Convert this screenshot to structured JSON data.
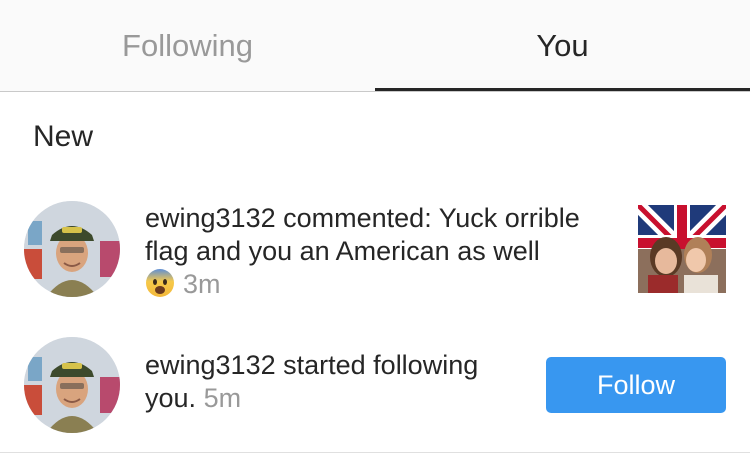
{
  "tabs": {
    "following_label": "Following",
    "you_label": "You",
    "active": "You"
  },
  "section_header": "New",
  "notifications": [
    {
      "username": "ewing3132",
      "action_text": " commented: Yuck orrible flag and you an American as well",
      "emoji": "fearful-face-emoji",
      "time": "3m",
      "thumbnail": "photo-two-people-union-jack"
    },
    {
      "username": "ewing3132",
      "action_text": " started following you.",
      "time": "5m",
      "button_label": "Follow"
    }
  ],
  "colors": {
    "accent_blue": "#3897f0",
    "muted_text": "#999999",
    "primary_text": "#262626"
  }
}
